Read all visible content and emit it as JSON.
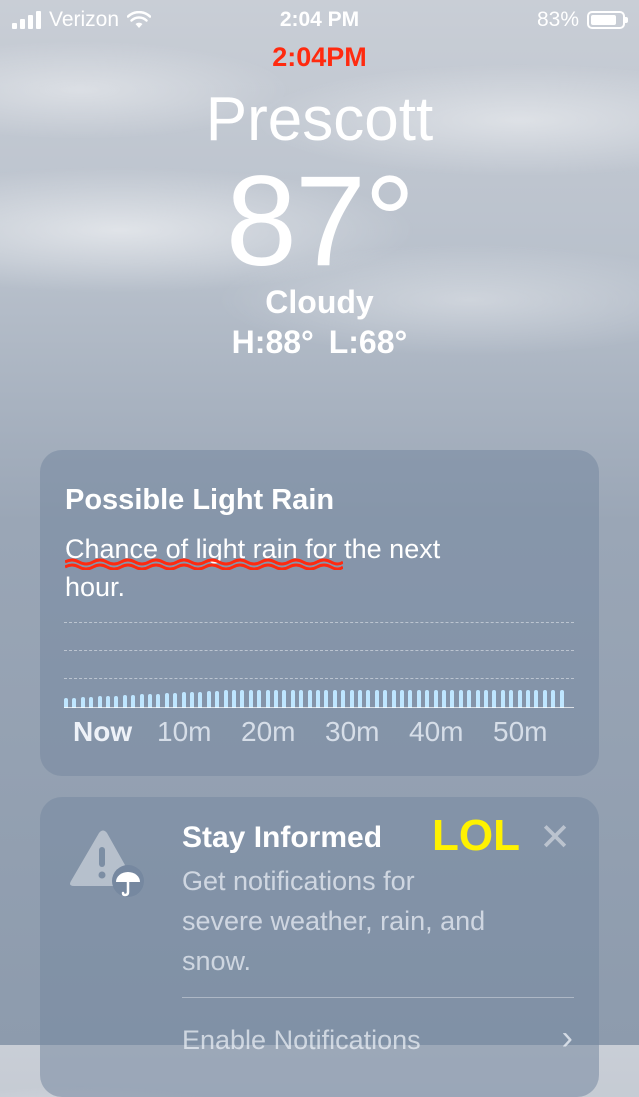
{
  "status_bar": {
    "carrier": "Verizon",
    "time": "2:04 PM",
    "battery_percent": "83%",
    "battery_level": 0.83
  },
  "annotation_time": "2:04PM",
  "weather": {
    "city": "Prescott",
    "temperature": "87°",
    "condition": "Cloudy",
    "high_low": "H:88° L:68°"
  },
  "rain_card": {
    "title": "Possible Light Rain",
    "description": "Chance of light rain for the next hour.",
    "axis_labels": [
      "Now",
      "10m",
      "20m",
      "30m",
      "40m",
      "50m"
    ]
  },
  "info_card": {
    "title": "Stay Informed",
    "annotation": "LOL",
    "description": "Get notifications for severe weather, rain, and snow.",
    "action_label": "Enable Notifications"
  },
  "colors": {
    "annotation_red": "#ff2a0f",
    "annotation_yellow": "#fff200",
    "rain_bar": "#bfe6ff"
  }
}
